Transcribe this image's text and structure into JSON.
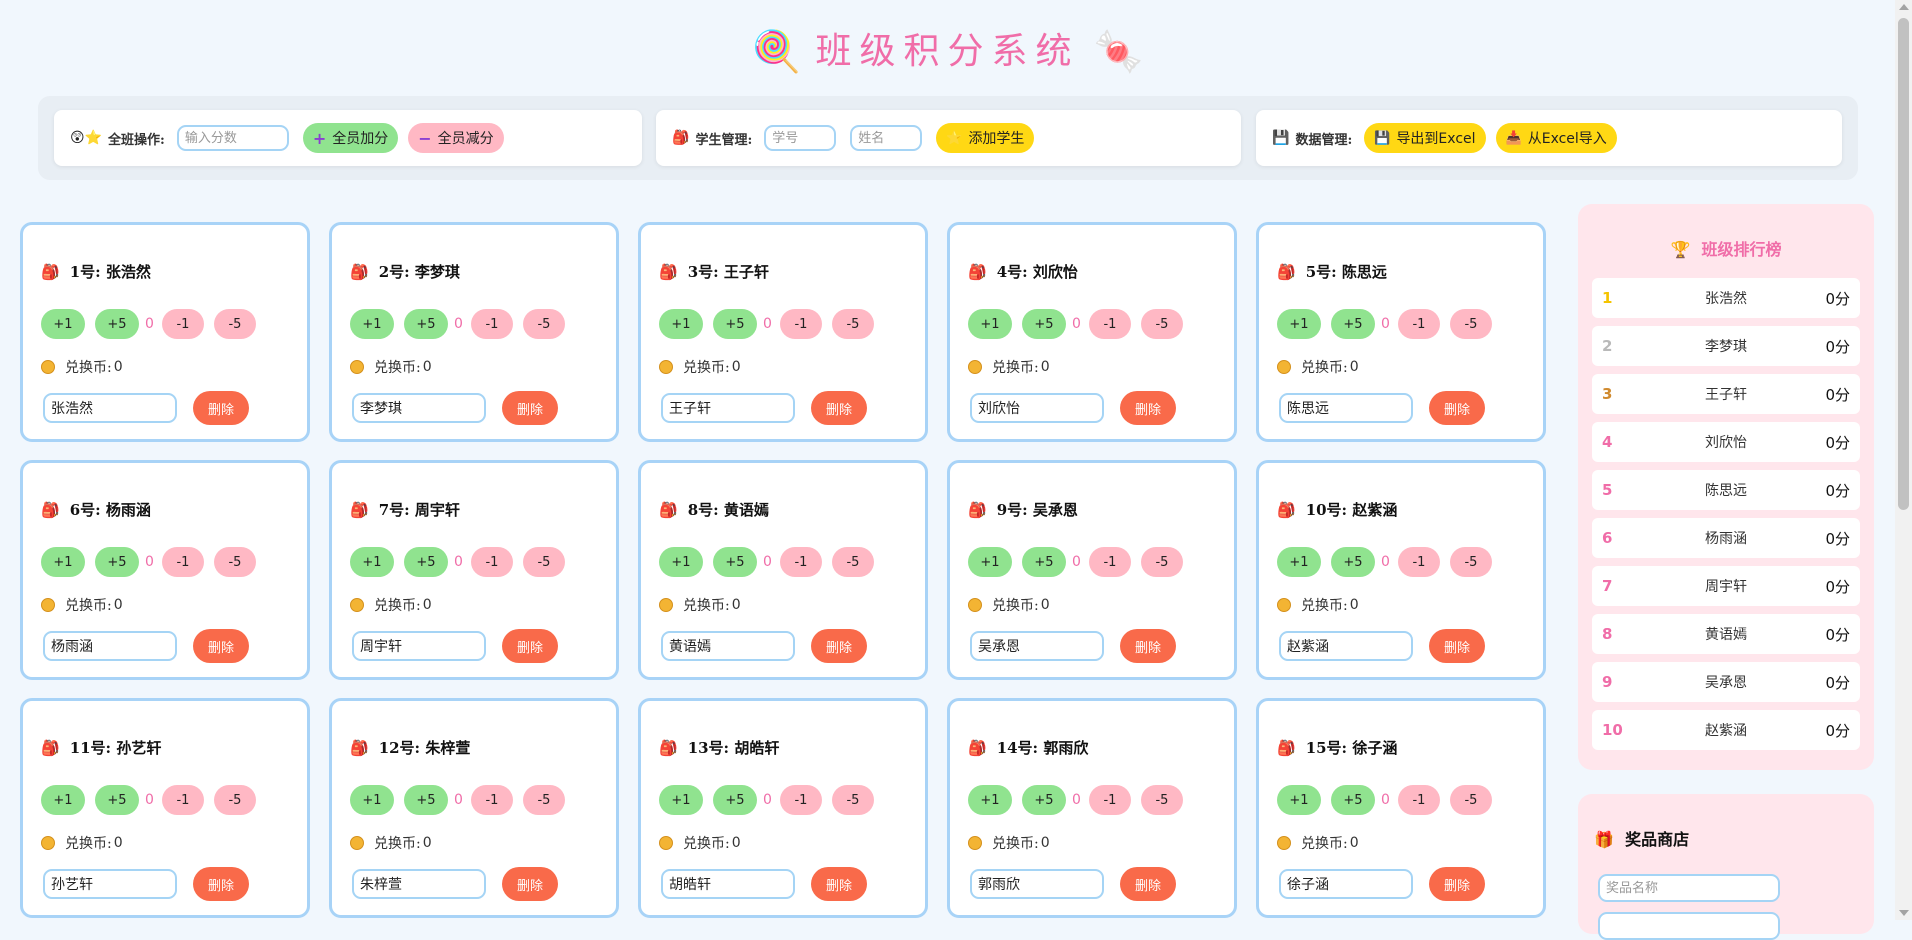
{
  "header": {
    "title": "班级积分系统",
    "left_icon": "🍭",
    "right_icon": "🍬"
  },
  "toolbar": {
    "class_ops": {
      "icon": "😲⭐",
      "label": "全班操作:",
      "input_placeholder": "输入分数",
      "add_all": "全员加分",
      "sub_all": "全员减分"
    },
    "student_mgmt": {
      "icon": "🎒",
      "label": "学生管理:",
      "id_placeholder": "学号",
      "name_placeholder": "姓名",
      "add_student": "添加学生",
      "add_icon": "⭐"
    },
    "data_mgmt": {
      "icon": "💾",
      "label": "数据管理:",
      "export": "导出到Excel",
      "export_icon": "💾",
      "import": "从Excel导入",
      "import_icon": "📥"
    }
  },
  "card_labels": {
    "plus1": "+1",
    "plus5": "+5",
    "minus1": "-1",
    "minus5": "-5",
    "coins_label": "兑换币:",
    "delete": "删除"
  },
  "students": [
    {
      "title": "1号: 张浩然",
      "score": "0",
      "coins": "0",
      "name": "张浩然"
    },
    {
      "title": "2号: 李梦琪",
      "score": "0",
      "coins": "0",
      "name": "李梦琪"
    },
    {
      "title": "3号: 王子轩",
      "score": "0",
      "coins": "0",
      "name": "王子轩"
    },
    {
      "title": "4号: 刘欣怡",
      "score": "0",
      "coins": "0",
      "name": "刘欣怡"
    },
    {
      "title": "5号: 陈思远",
      "score": "0",
      "coins": "0",
      "name": "陈思远"
    },
    {
      "title": "6号: 杨雨涵",
      "score": "0",
      "coins": "0",
      "name": "杨雨涵"
    },
    {
      "title": "7号: 周宇轩",
      "score": "0",
      "coins": "0",
      "name": "周宇轩"
    },
    {
      "title": "8号: 黄语嫣",
      "score": "0",
      "coins": "0",
      "name": "黄语嫣"
    },
    {
      "title": "9号: 吴承恩",
      "score": "0",
      "coins": "0",
      "name": "吴承恩"
    },
    {
      "title": "10号: 赵紫涵",
      "score": "0",
      "coins": "0",
      "name": "赵紫涵"
    },
    {
      "title": "11号: 孙艺轩",
      "score": "0",
      "coins": "0",
      "name": "孙艺轩"
    },
    {
      "title": "12号: 朱梓萱",
      "score": "0",
      "coins": "0",
      "name": "朱梓萱"
    },
    {
      "title": "13号: 胡皓轩",
      "score": "0",
      "coins": "0",
      "name": "胡皓轩"
    },
    {
      "title": "14号: 郭雨欣",
      "score": "0",
      "coins": "0",
      "name": "郭雨欣"
    },
    {
      "title": "15号: 徐子涵",
      "score": "0",
      "coins": "0",
      "name": "徐子涵"
    }
  ],
  "ranking": {
    "title": "班级排行榜",
    "icon": "🏆",
    "rows": [
      {
        "rank": "1",
        "name": "张浩然",
        "score": "0分",
        "color": "#f5c400"
      },
      {
        "rank": "2",
        "name": "李梦琪",
        "score": "0分",
        "color": "#b9b9b9"
      },
      {
        "rank": "3",
        "name": "王子轩",
        "score": "0分",
        "color": "#d08a2e"
      },
      {
        "rank": "4",
        "name": "刘欣怡",
        "score": "0分",
        "color": "#f06da8"
      },
      {
        "rank": "5",
        "name": "陈思远",
        "score": "0分",
        "color": "#f06da8"
      },
      {
        "rank": "6",
        "name": "杨雨涵",
        "score": "0分",
        "color": "#f06da8"
      },
      {
        "rank": "7",
        "name": "周宇轩",
        "score": "0分",
        "color": "#f06da8"
      },
      {
        "rank": "8",
        "name": "黄语嫣",
        "score": "0分",
        "color": "#f06da8"
      },
      {
        "rank": "9",
        "name": "吴承恩",
        "score": "0分",
        "color": "#f06da8"
      },
      {
        "rank": "10",
        "name": "赵紫涵",
        "score": "0分",
        "color": "#f06da8"
      }
    ]
  },
  "shop": {
    "title": "奖品商店",
    "icon": "🎁",
    "prize_placeholder": "奖品名称"
  },
  "colors": {
    "accent_pink": "#f06da8",
    "plus_green": "#90e38f",
    "minus_pink": "#ffb8c4",
    "delete_red": "#f96a4a",
    "yellow": "#ffd814",
    "card_border": "#a8d3f7"
  }
}
